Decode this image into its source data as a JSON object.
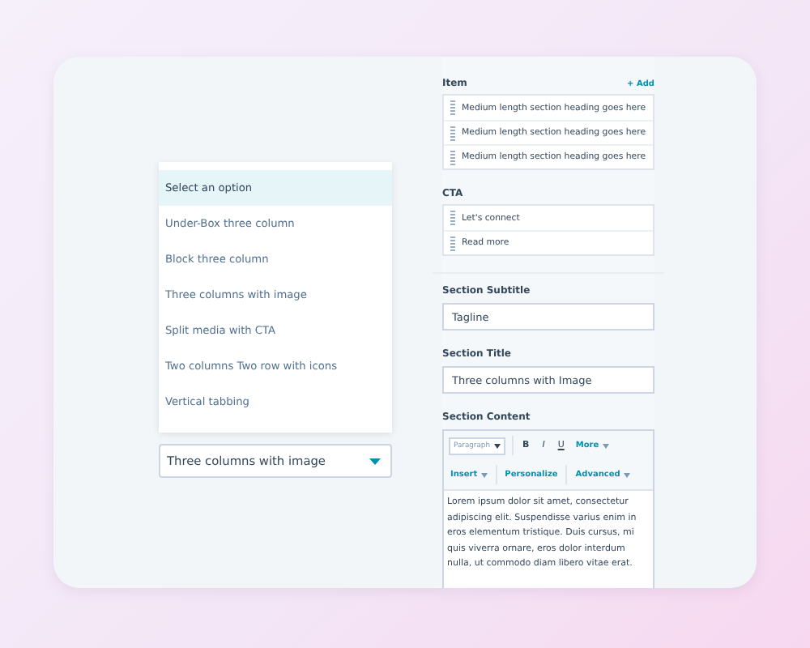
{
  "dropdown": {
    "options": [
      {
        "label": "Select an option",
        "highlighted": true
      },
      {
        "label": "Under-Box three column",
        "highlighted": false
      },
      {
        "label": "Block three column",
        "highlighted": false
      },
      {
        "label": "Three columns with image",
        "highlighted": false
      },
      {
        "label": "Split media with CTA",
        "highlighted": false
      },
      {
        "label": "Two columns Two row with icons",
        "highlighted": false
      },
      {
        "label": "Vertical tabbing",
        "highlighted": false
      }
    ],
    "value": "Three columns with image"
  },
  "item": {
    "label": "Item",
    "add": "+ Add",
    "rows": [
      "Medium length section heading goes here",
      "Medium length section heading goes here",
      "Medium length section heading goes here"
    ]
  },
  "cta": {
    "label": "CTA",
    "rows": [
      "Let's connect",
      "Read more"
    ]
  },
  "section_subtitle": {
    "label": "Section Subtitle",
    "value": "Tagline"
  },
  "section_title": {
    "label": "Section Title",
    "value": "Three columns with Image"
  },
  "section_content": {
    "label": "Section Content",
    "toolbar": {
      "paragraph": "Paragraph",
      "bold": "B",
      "italic": "I",
      "underline": "U",
      "more": "More",
      "insert": "Insert",
      "personalize": "Personalize",
      "advanced": "Advanced"
    },
    "text": "Lorem ipsum dolor sit amet, consectetur adipiscing elit. Suspendisse varius enim in eros elementum tristique. Duis cursus, mi quis viverra ornare, eros dolor interdum nulla, ut commodo diam libero vitae erat."
  }
}
